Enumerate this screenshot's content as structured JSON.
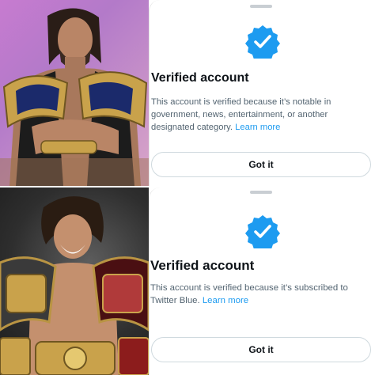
{
  "panels": [
    {
      "photo": {
        "description_icon": "wrestler-with-championship-belts"
      },
      "dialog": {
        "badge_icon": "verified-badge-icon",
        "title": "Verified account",
        "body": "This account is verified because it’s notable in government, news, entertainment, or another designated category.",
        "learn_more": "Learn more",
        "button": "Got it"
      }
    },
    {
      "photo": {
        "description_icon": "wrestler-with-championship-belts"
      },
      "dialog": {
        "badge_icon": "verified-badge-icon",
        "title": "Verified account",
        "body": "This account is verified because it’s subscribed to Twitter Blue.",
        "learn_more": "Learn more",
        "button": "Got it"
      }
    }
  ],
  "colors": {
    "badge": "#1d9bf0",
    "link": "#1d9bf0",
    "title": "#0f1419",
    "body": "#536471",
    "button_border": "#cfd9de"
  }
}
